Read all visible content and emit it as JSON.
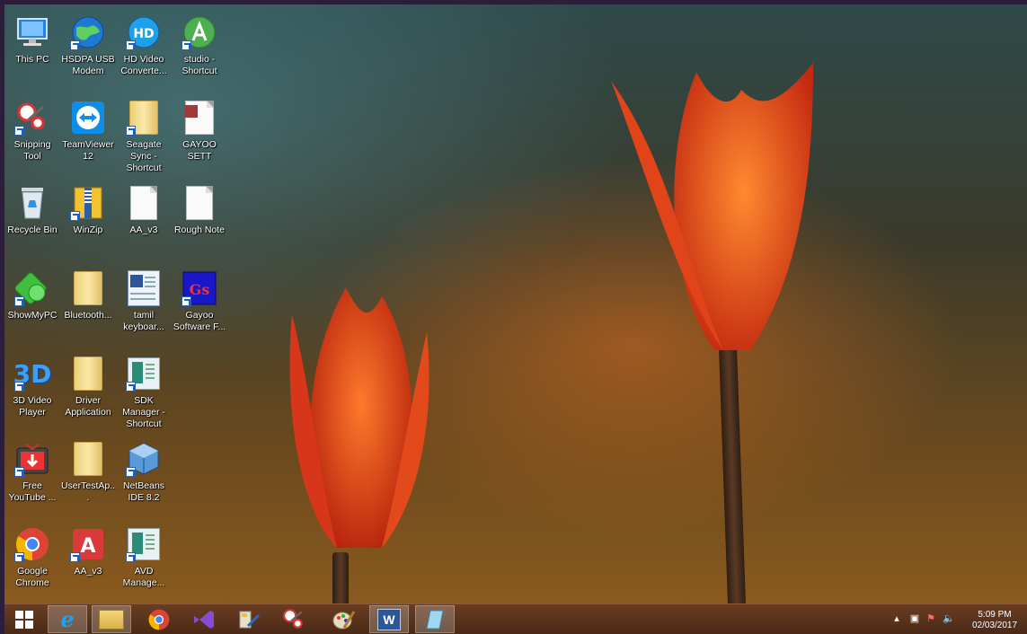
{
  "desktop": {
    "icons": [
      {
        "label": "This PC",
        "icon": "this-pc-icon"
      },
      {
        "label": "HSDPA USB Modem",
        "icon": "globe-icon"
      },
      {
        "label": "HD Video Converte...",
        "icon": "hd-video-icon"
      },
      {
        "label": "studio - Shortcut",
        "icon": "android-studio-icon"
      },
      {
        "label": "Snipping Tool",
        "icon": "scissors-icon"
      },
      {
        "label": "TeamViewer 12",
        "icon": "teamviewer-icon"
      },
      {
        "label": "Seagate Sync - Shortcut",
        "icon": "folder-icon"
      },
      {
        "label": "GAYOO SETT",
        "icon": "access-document-icon"
      },
      {
        "label": "Recycle Bin",
        "icon": "recycle-bin-icon"
      },
      {
        "label": "WinZip",
        "icon": "winzip-icon"
      },
      {
        "label": "AA_v3",
        "icon": "document-icon"
      },
      {
        "label": "Rough Note",
        "icon": "document-icon"
      },
      {
        "label": "ShowMyPC",
        "icon": "showmypc-icon"
      },
      {
        "label": "Bluetooth...",
        "icon": "folder-icon"
      },
      {
        "label": "tamil keyboar...",
        "icon": "word-document-icon"
      },
      {
        "label": "Gayoo Software F...",
        "icon": "gayoo-software-icon"
      },
      {
        "label": "3D Video Player",
        "icon": "3d-video-icon"
      },
      {
        "label": "Driver Application",
        "icon": "folder-icon"
      },
      {
        "label": "SDK Manager - Shortcut",
        "icon": "sdk-manager-icon"
      },
      {
        "label": "Free YouTube ...",
        "icon": "youtube-download-icon"
      },
      {
        "label": "UserTestAp...",
        "icon": "folder-icon"
      },
      {
        "label": "NetBeans IDE 8.2",
        "icon": "netbeans-icon"
      },
      {
        "label": "Google Chrome",
        "icon": "chrome-icon"
      },
      {
        "label": "AA_v3",
        "icon": "acrobat-icon"
      },
      {
        "label": "AVD Manage...",
        "icon": "avd-manager-icon"
      }
    ]
  },
  "taskbar": {
    "items": [
      {
        "icon": "windows-start-icon"
      },
      {
        "icon": "internet-explorer-icon"
      },
      {
        "icon": "file-explorer-icon"
      },
      {
        "icon": "chrome-icon"
      },
      {
        "icon": "visual-studio-icon"
      },
      {
        "icon": "image-tool-icon"
      },
      {
        "icon": "snipping-tool-icon"
      },
      {
        "icon": "paint-icon"
      },
      {
        "icon": "word-icon"
      },
      {
        "icon": "notepad-icon"
      }
    ],
    "tray": {
      "time": "5:09 PM",
      "date": "02/03/2017"
    }
  },
  "colors": {
    "taskbar": "#5a3320",
    "frame": "#2a1e3a",
    "flower": "#e8421c"
  }
}
